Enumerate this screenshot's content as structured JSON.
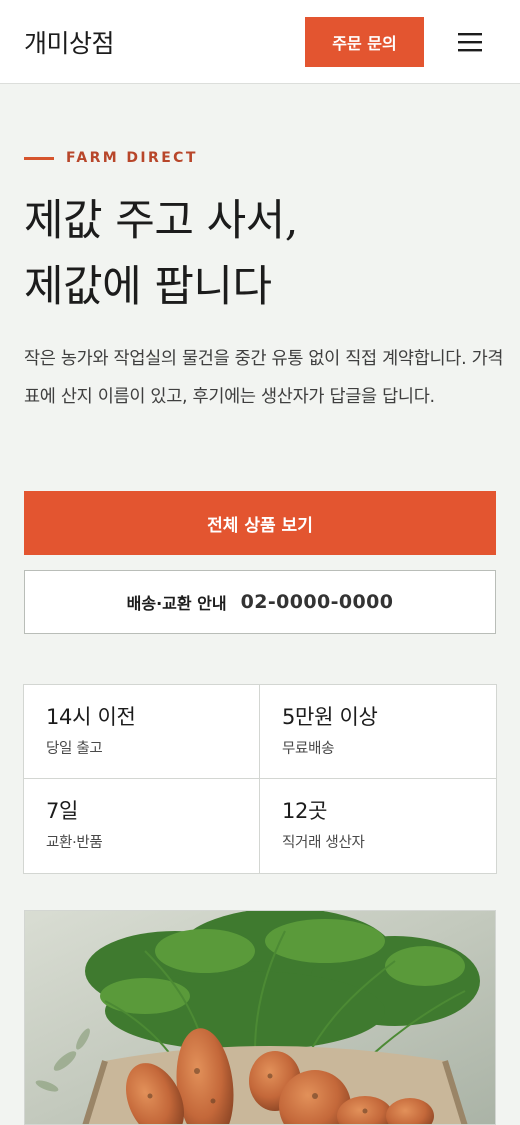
{
  "header": {
    "brand": "개미상점",
    "order_button": "주문 문의",
    "menu_icon": "hamburger-menu-icon"
  },
  "hero": {
    "eyebrow": "FARM DIRECT",
    "headline_line1": "제값 주고 사서,",
    "headline_line2": "제값에 팝니다",
    "intro": "작은 농가와 작업실의 물건을 중간 유통 없이 직접 계약합니다. 가격표에 산지 이름이 있고, 후기에는 생산자가 답글을 답니다.",
    "primary_cta": "전체 상품 보기",
    "secondary_cta_label": "배송·교환 안내",
    "secondary_cta_phone": "02-0000-0000"
  },
  "stats": [
    {
      "value": "14시 이전",
      "label": "당일 출고"
    },
    {
      "value": "5만원 이상",
      "label": "무료배송"
    },
    {
      "value": "7일",
      "label": "교환·반품"
    },
    {
      "value": "12곳",
      "label": "직거래 생산자"
    }
  ],
  "colors": {
    "accent": "#e35530",
    "eyebrow": "#b8462a",
    "background": "#f2f4f1"
  },
  "image": {
    "subject": "carrots-in-basket-photo"
  }
}
